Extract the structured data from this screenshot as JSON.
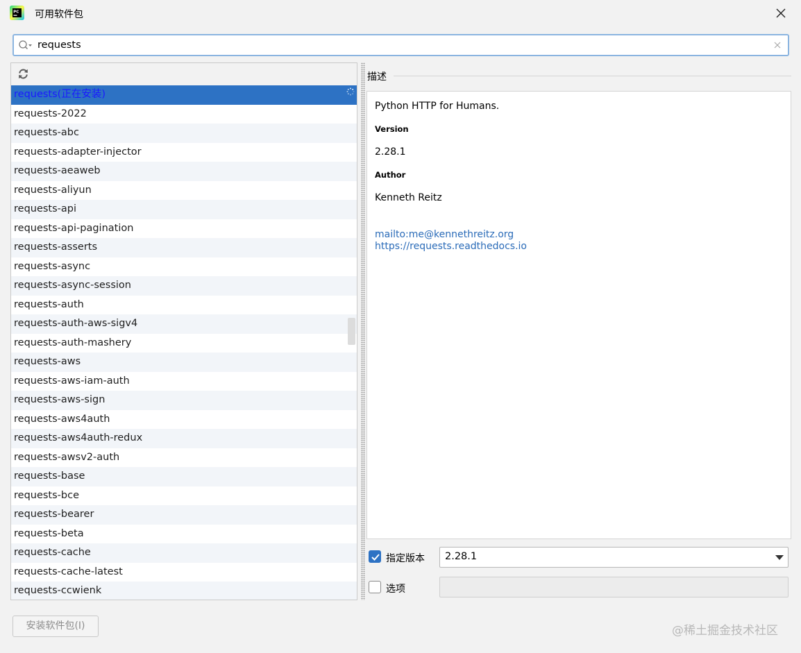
{
  "window": {
    "title": "可用软件包",
    "app_icon": "pycharm-icon"
  },
  "search": {
    "value": "requests",
    "icon": "search-icon"
  },
  "packages": [
    "requests(正在安装)",
    "requests-2022",
    "requests-abc",
    "requests-adapter-injector",
    "requests-aeaweb",
    "requests-aliyun",
    "requests-api",
    "requests-api-pagination",
    "requests-asserts",
    "requests-async",
    "requests-async-session",
    "requests-auth",
    "requests-auth-aws-sigv4",
    "requests-auth-mashery",
    "requests-aws",
    "requests-aws-iam-auth",
    "requests-aws-sign",
    "requests-aws4auth",
    "requests-aws4auth-redux",
    "requests-awsv2-auth",
    "requests-base",
    "requests-bce",
    "requests-bearer",
    "requests-beta",
    "requests-cache",
    "requests-cache-latest",
    "requests-ccwienk"
  ],
  "selected_index": 0,
  "description": {
    "header": "描述",
    "summary": "Python HTTP for Humans.",
    "version_label": "Version",
    "version_value": "2.28.1",
    "author_label": "Author",
    "author_value": "Kenneth Reitz",
    "links": [
      "mailto:me@kennethreitz.org",
      "https://requests.readthedocs.io"
    ]
  },
  "controls": {
    "specify_version_label": "指定版本",
    "specify_version_checked": true,
    "version_selected": "2.28.1",
    "options_label": "选项",
    "options_checked": false,
    "options_value": ""
  },
  "install_button": {
    "label": "安装软件包(I)",
    "enabled": false
  },
  "watermark": "@稀土掘金技术社区",
  "colors": {
    "selection": "#2d72c4",
    "link": "#2a6bb8",
    "alt_row": "#f2f5f9",
    "search_border": "#8ab4e0"
  }
}
